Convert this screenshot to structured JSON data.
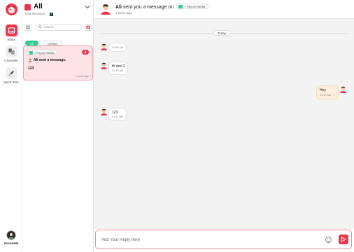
{
  "rail": {
    "items": [
      {
        "label": "Inbox",
        "icon": "inbox-icon"
      },
      {
        "label": "Channels",
        "icon": "channels-icon"
      },
      {
        "label": "Quick Tour",
        "icon": "rocket-icon"
      }
    ],
    "account_label": "Accounts"
  },
  "panel": {
    "title": "All",
    "total_label": "Total Messages :",
    "total_count": "1",
    "search_placeholder": "Search",
    "filters": [
      {
        "label": "All",
        "active": true
      },
      {
        "label": "Unread",
        "active": false
      }
    ],
    "conversation": {
      "source": "/ Payoni Media",
      "title": "Ali sent a message.",
      "preview": "123",
      "time": "7 hours ago"
    }
  },
  "chat": {
    "sender": "Ali",
    "header_text": "sent you a message on",
    "source": "/ Payoni Media",
    "header_time": "7 hours ago",
    "day_label": "Today",
    "messages": [
      {
        "text": "",
        "time": "01:36 AM",
        "from": "them"
      },
      {
        "text": "Hi dec 2",
        "time": "01:36 AM",
        "from": "them"
      },
      {
        "text": "Hey",
        "time": "01:37 AM",
        "from": "me"
      },
      {
        "text": "123",
        "time": "01:37 AM",
        "from": "them"
      }
    ],
    "reply_placeholder": "Add Your Reply here"
  },
  "colors": {
    "accent": "#e8384f",
    "success": "#2ecc8f",
    "selected_bg": "#fde3e6",
    "outgoing_bg": "#fbeedc"
  }
}
